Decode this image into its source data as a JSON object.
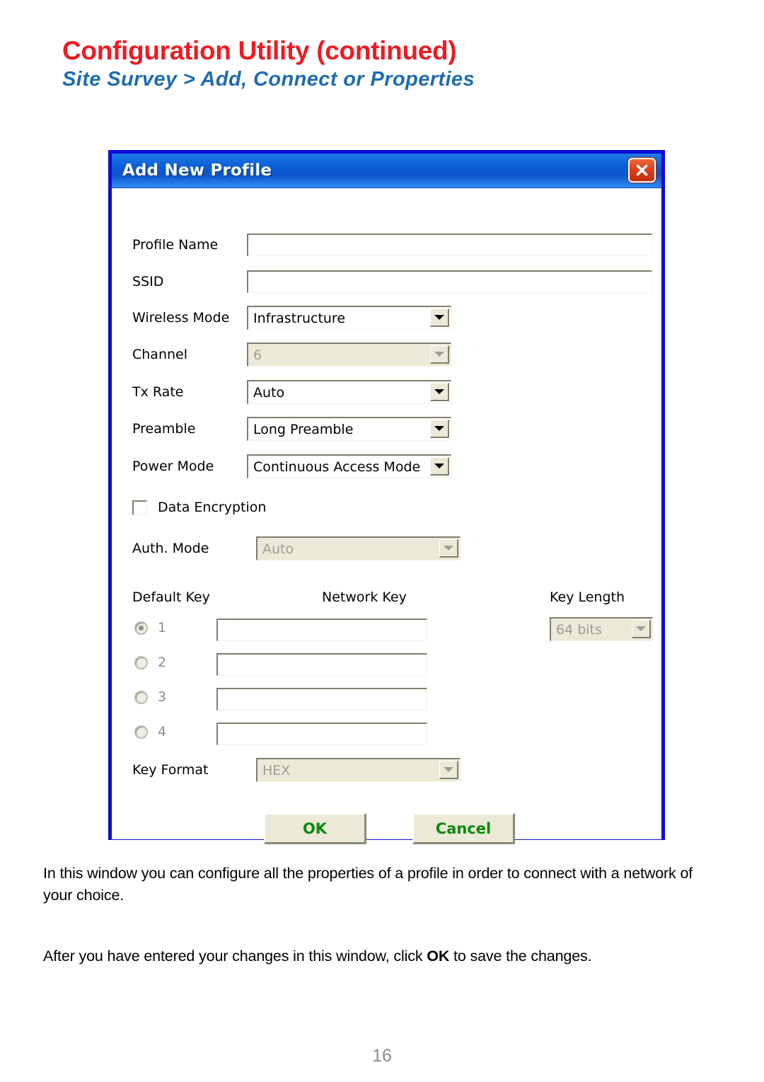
{
  "header": {
    "title": "Configuration Utility (continued)",
    "subtitle": "Site Survey > Add, Connect or Properties",
    "title_color": "#ed1c24",
    "subtitle_color": "#1f6cb0"
  },
  "dialog": {
    "title": "Add New Profile",
    "close_icon": "close-x-icon",
    "border_color": "#0b0bd9",
    "titlebar_color": "#0b5fd6",
    "fields": {
      "profile_name": {
        "label": "Profile Name",
        "value": "",
        "type": "text",
        "enabled": true
      },
      "ssid": {
        "label": "SSID",
        "value": "",
        "type": "text",
        "enabled": true
      },
      "wireless_mode": {
        "label": "Wireless Mode",
        "value": "Infrastructure",
        "type": "combo",
        "enabled": true
      },
      "channel": {
        "label": "Channel",
        "value": "6",
        "type": "combo",
        "enabled": false
      },
      "tx_rate": {
        "label": "Tx Rate",
        "value": "Auto",
        "type": "combo",
        "enabled": true
      },
      "preamble": {
        "label": "Preamble",
        "value": "Long Preamble",
        "type": "combo",
        "enabled": true
      },
      "power_mode": {
        "label": "Power Mode",
        "value": "Continuous Access Mode",
        "type": "combo",
        "enabled": true
      },
      "data_encryption": {
        "label": "Data Encryption",
        "checked": false,
        "type": "checkbox",
        "enabled": true
      },
      "auth_mode": {
        "label": "Auth. Mode",
        "value": "Auto",
        "type": "combo",
        "enabled": false
      },
      "key_format": {
        "label": "Key Format",
        "value": "HEX",
        "type": "combo",
        "enabled": false
      }
    },
    "key_section": {
      "default_key_heading": "Default Key",
      "network_key_heading": "Network Key",
      "key_length_heading": "Key Length",
      "key_length_value": "64 bits",
      "key_length_enabled": false,
      "selected_key": 1,
      "keys": [
        {
          "num": "1",
          "value": "",
          "selected": true
        },
        {
          "num": "2",
          "value": "",
          "selected": false
        },
        {
          "num": "3",
          "value": "",
          "selected": false
        },
        {
          "num": "4",
          "value": "",
          "selected": false
        }
      ]
    },
    "buttons": {
      "ok": "OK",
      "cancel": "Cancel",
      "label_color": "#0a8a0a"
    }
  },
  "body": {
    "paragraph1": "In this window you can configure all the properties of a profile in order to connect with a network of your choice.",
    "paragraph2_before": "After you have entered your changes in this window, click ",
    "paragraph2_bold": "OK",
    "paragraph2_after": " to save the changes."
  },
  "footer": {
    "page_number": "16"
  }
}
